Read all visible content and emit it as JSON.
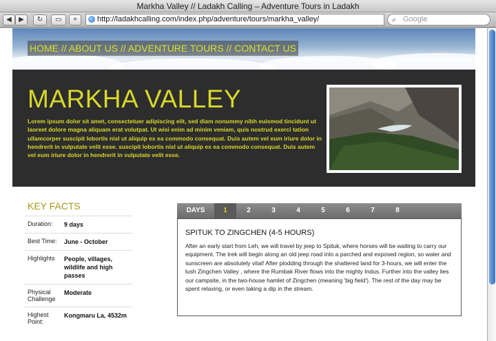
{
  "window": {
    "title": "Markha Valley // Ladakh Calling – Adventure Tours in Ladakh"
  },
  "toolbar": {
    "back_icon": "back-arrow-icon",
    "forward_icon": "forward-arrow-icon",
    "reload_icon": "reload-icon",
    "url": "http://ladakhcalling.com/index.php/adventure/tours/markha_valley/",
    "search_placeholder": "Google"
  },
  "nav": {
    "items": [
      "HOME",
      "ABOUT US",
      "ADVENTURE TOURS",
      "CONTACT US"
    ],
    "separator": " // "
  },
  "hero": {
    "title": "MARKHA VALLEY",
    "text": "Lorem ipsum dolor sit amet, consectetuer adipiscing elit, sed diam nonummy nibh euismod tincidunt ut laoreet dolore magna aliquam erat volutpat. Ut wisi enim ad minim veniam, quis nostrud exerci tation ullamcorper suscipit lobortis nisl ut aliquip ex ea commodo consequat. Duis autem vel eum iriure dolor in hendrerit in vulputate velit esse. suscipit lobortis nisl ut aliquip ex ea commodo consequat. Duis autem vel eum iriure dolor in hendrerit in vulputate velit esse."
  },
  "key_facts": {
    "title": "KEY FACTS",
    "rows": [
      {
        "key": "Duration:",
        "value": "9 days"
      },
      {
        "key": "Best Time:",
        "value": "June - October"
      },
      {
        "key": "Highlights",
        "value": "People, villages, wildlife and high passes"
      },
      {
        "key": "Physical Challenge",
        "value": "Moderate"
      },
      {
        "key": "Highest Point:",
        "value": "Kongmaru La, 4532m"
      }
    ]
  },
  "itinerary": {
    "tabs_label": "DAYS",
    "days": [
      "1",
      "2",
      "3",
      "4",
      "5",
      "6",
      "7",
      "8"
    ],
    "active_day": "1",
    "heading": "SPITUK TO ZINGCHEN (4-5 HOURS)",
    "body": "After an early start from Leh, we will travel by jeep to Spituk, where horses will be waiting to carry our equipment. The trek will begin along an old jeep road into a parched and exposed region, so water and sunscreen are absolutely vital! After plodding through the shattered land for 3-hours, we will enter the lush Zingchen Valley , where the Rumbak River flows into the mighty Indus. Further into the valley lies our campsite, in the two-house hamlet of Zingchen (meaning 'big field'). The rest of the day may be spent relaxing, or even taking a dip in the stream."
  },
  "colors": {
    "accent": "#d8d82a",
    "dark": "#2d2d2d",
    "facts_title": "#a39a1a"
  }
}
